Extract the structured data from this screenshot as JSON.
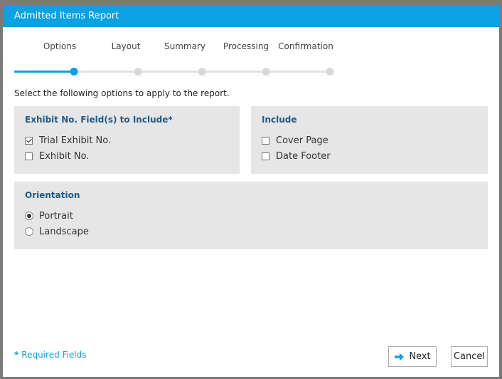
{
  "window": {
    "title": "Admitted Items Report"
  },
  "wizard": {
    "steps": [
      {
        "label": "Options",
        "active": true
      },
      {
        "label": "Layout",
        "active": false
      },
      {
        "label": "Summary",
        "active": false
      },
      {
        "label": "Processing",
        "active": false
      },
      {
        "label": "Confirmation",
        "active": false
      }
    ]
  },
  "intro": "Select the following options to apply to the report.",
  "exhibit_panel": {
    "title": "Exhibit No. Field(s) to Include*",
    "options": [
      {
        "label": "Trial Exhibit No.",
        "checked": true
      },
      {
        "label": "Exhibit No.",
        "checked": false
      }
    ]
  },
  "include_panel": {
    "title": "Include",
    "options": [
      {
        "label": "Cover Page",
        "checked": false
      },
      {
        "label": "Date Footer",
        "checked": false
      }
    ]
  },
  "orientation_panel": {
    "title": "Orientation",
    "options": [
      {
        "label": "Portrait",
        "selected": true
      },
      {
        "label": "Landscape",
        "selected": false
      }
    ]
  },
  "footer": {
    "required_star": "*",
    "required_text": "Required Fields",
    "next_label": "Next",
    "cancel_label": "Cancel"
  },
  "colors": {
    "accent": "#0ba1e2",
    "panel_bg": "#e6e6e6",
    "panel_title": "#1f5b86",
    "required_text": "#1a9ad6"
  }
}
